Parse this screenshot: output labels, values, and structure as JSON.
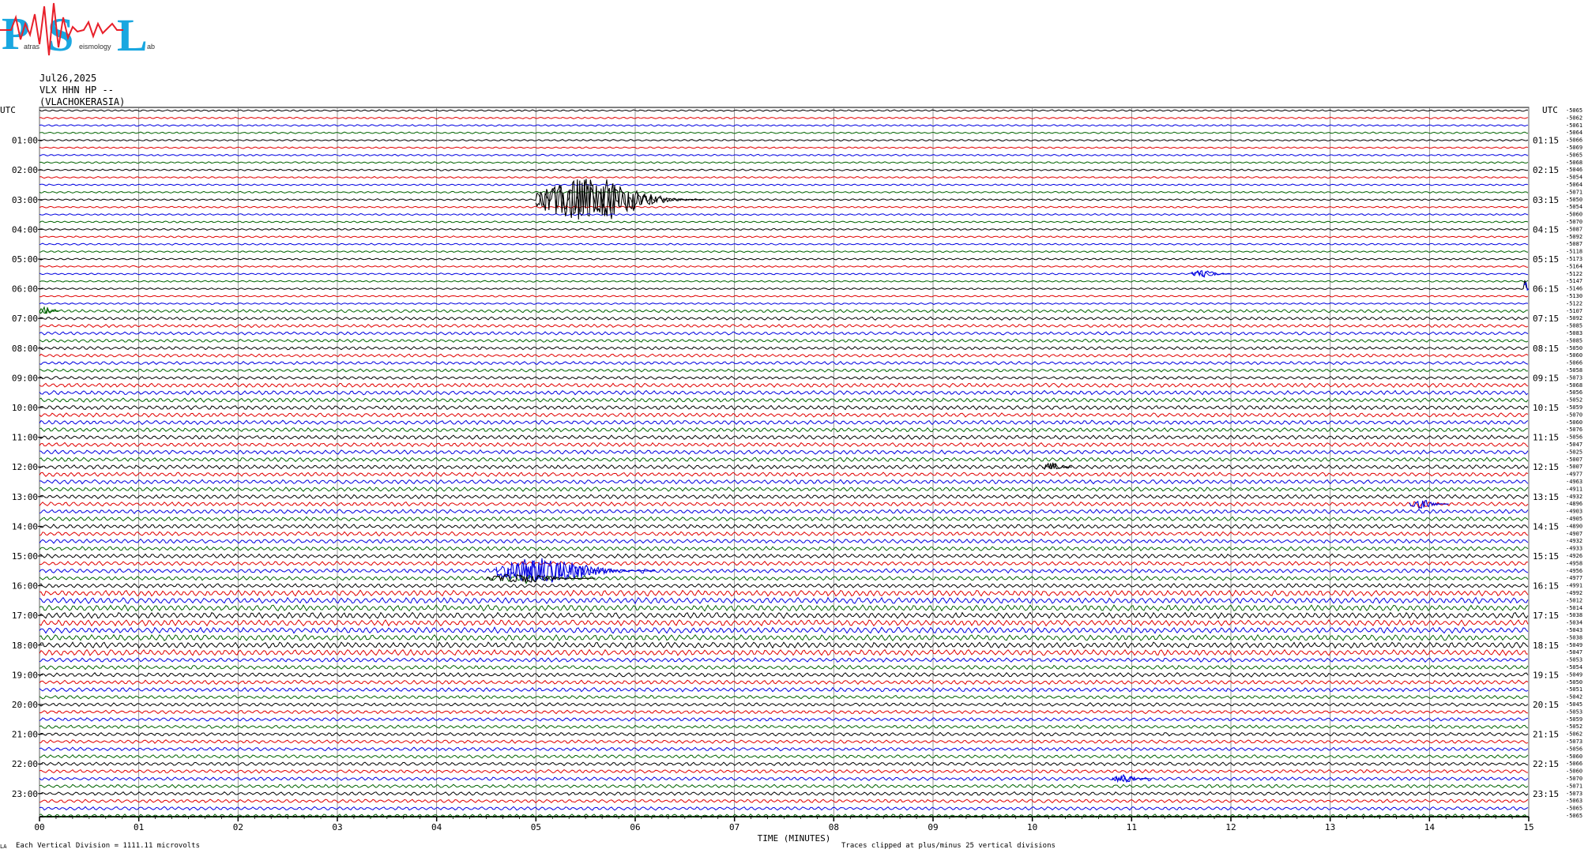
{
  "logo": {
    "letters": "PSL",
    "words": "Patras Seismology Lab",
    "colors": {
      "letters": "#19a7e0",
      "waveform": "#e8202a"
    }
  },
  "header": {
    "date": "Jul26,2025",
    "channel": "VLX HHN HP --",
    "station": "(VLACHOKERASIA)"
  },
  "footer": {
    "left_mark": "LA",
    "scale_note": "Each Vertical Division = 1111.11 microvolts",
    "xlabel": "TIME (MINUTES)",
    "clip_note": "Traces clipped at plus/minus 25 vertical divisions"
  },
  "chart_data": {
    "type": "line",
    "title": "",
    "xlabel": "TIME (MINUTES)",
    "ylabel": "UTC",
    "xlim": [
      0,
      15
    ],
    "x_ticks": [
      "00",
      "01",
      "02",
      "03",
      "04",
      "05",
      "06",
      "07",
      "08",
      "09",
      "10",
      "11",
      "12",
      "13",
      "14",
      "15"
    ],
    "left_utc_label": "UTC",
    "right_utc_label": "UTC",
    "left_ticks": [
      "01:00",
      "02:00",
      "03:00",
      "04:00",
      "05:00",
      "06:00",
      "07:00",
      "08:00",
      "09:00",
      "10:00",
      "11:00",
      "12:00",
      "13:00",
      "14:00",
      "15:00",
      "16:00",
      "17:00",
      "18:00",
      "19:00",
      "20:00",
      "21:00",
      "22:00",
      "23:00"
    ],
    "right_ticks": [
      "01:15",
      "02:15",
      "03:15",
      "04:15",
      "05:15",
      "06:15",
      "07:15",
      "08:15",
      "09:15",
      "10:15",
      "11:15",
      "12:15",
      "13:15",
      "14:15",
      "15:15",
      "16:15",
      "17:15",
      "18:15",
      "19:15",
      "20:15",
      "21:15",
      "22:15",
      "23:15"
    ],
    "trace_colors": [
      "#000000",
      "#e00000",
      "#0000e0",
      "#006400"
    ],
    "trace_count": 96,
    "grid": true,
    "trace_offsets": [
      "-5065",
      "-5062",
      "-5061",
      "-5064",
      "-5066",
      "-5069",
      "-5065",
      "-5068",
      "-5046",
      "-5054",
      "-5064",
      "-5071",
      "-5050",
      "-5054",
      "-5060",
      "-5070",
      "-5087",
      "-5092",
      "-5087",
      "-5118",
      "-5173",
      "-5164",
      "-5122",
      "-5147",
      "-5146",
      "-5130",
      "-5122",
      "-5107",
      "-5092",
      "-5085",
      "-5083",
      "-5085",
      "-5050",
      "-5060",
      "-5066",
      "-5058",
      "-5073",
      "-5068",
      "-5056",
      "-5052",
      "-5059",
      "-5070",
      "-5060",
      "-5076",
      "-5056",
      "-5047",
      "-5025",
      "-5007",
      "-5007",
      "-4977",
      "-4963",
      "-4911",
      "-4932",
      "-4896",
      "-4903",
      "-4905",
      "-4890",
      "-4907",
      "-4932",
      "-4933",
      "-4926",
      "-4958",
      "-4956",
      "-4977",
      "-4991",
      "-4992",
      "-5012",
      "-5014",
      "-5038",
      "-5034",
      "-5043",
      "-5038",
      "-5049",
      "-5047",
      "-5053",
      "-5054",
      "-5049",
      "-5050",
      "-5051",
      "-5042",
      "-5045",
      "-5053",
      "-5059",
      "-5052",
      "-5062",
      "-5073",
      "-5056",
      "-5060",
      "-5066",
      "-5060",
      "-5070",
      "-5071",
      "-5073",
      "-5063",
      "-5065",
      "-5065"
    ],
    "events": [
      {
        "trace": 12,
        "start_min": 5.0,
        "end_min": 6.7,
        "peak_divisions": 25,
        "color": "#000000"
      },
      {
        "trace": 62,
        "start_min": 4.6,
        "end_min": 6.2,
        "peak_divisions": 14,
        "color": "#0000e0"
      },
      {
        "trace": 63,
        "start_min": 4.5,
        "end_min": 5.6,
        "peak_divisions": 5,
        "color": "#000000"
      },
      {
        "trace": 24,
        "start_min": 14.95,
        "end_min": 15.0,
        "peak_divisions": 12,
        "color": "#0000e0"
      },
      {
        "trace": 27,
        "start_min": 0.0,
        "end_min": 0.2,
        "peak_divisions": 5,
        "color": "#006400"
      },
      {
        "trace": 48,
        "start_min": 10.1,
        "end_min": 10.4,
        "peak_divisions": 5,
        "color": "#000000"
      },
      {
        "trace": 53,
        "start_min": 13.8,
        "end_min": 14.2,
        "peak_divisions": 5,
        "color": "#0000e0"
      },
      {
        "trace": 22,
        "start_min": 11.6,
        "end_min": 12.0,
        "peak_divisions": 4,
        "color": "#0000e0"
      },
      {
        "trace": 90,
        "start_min": 10.8,
        "end_min": 11.2,
        "peak_divisions": 4,
        "color": "#0000e0"
      }
    ]
  }
}
